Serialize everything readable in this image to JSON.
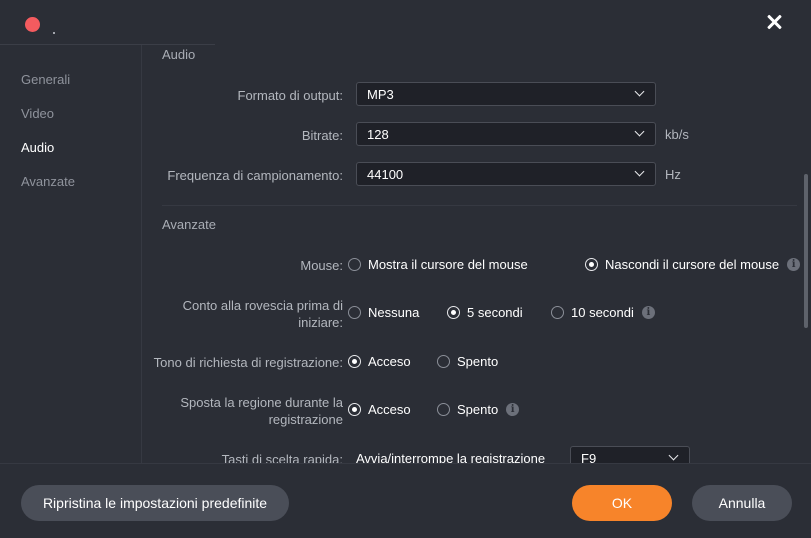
{
  "sidebar": {
    "items": [
      {
        "label": "Generali",
        "active": false
      },
      {
        "label": "Video",
        "active": false
      },
      {
        "label": "Audio",
        "active": true
      },
      {
        "label": "Avanzate",
        "active": false
      }
    ]
  },
  "audio": {
    "title": "Audio",
    "format_label": "Formato di output:",
    "format_value": "MP3",
    "bitrate_label": "Bitrate:",
    "bitrate_value": "128",
    "bitrate_unit": "kb/s",
    "samplerate_label": "Frequenza di campionamento:",
    "samplerate_value": "44100",
    "samplerate_unit": "Hz"
  },
  "advanced": {
    "title": "Avanzate",
    "mouse_label": "Mouse:",
    "mouse_show": "Mostra il cursore del mouse",
    "mouse_hide": "Nascondi il cursore del mouse",
    "countdown_label_1": "Conto alla rovescia prima di",
    "countdown_label_2": "iniziare:",
    "countdown_none": "Nessuna",
    "countdown_5": "5 secondi",
    "countdown_10": "10 secondi",
    "tone_label": "Tono di richiesta di registrazione:",
    "tone_on": "Acceso",
    "tone_off": "Spento",
    "move_label_1": "Sposta la regione durante la",
    "move_label_2": "registrazione",
    "move_on": "Acceso",
    "move_off": "Spento",
    "hotkeys_label": "Tasti di scelta rapida:",
    "hotkeys_action": "Avvia/interrompe la registrazione",
    "hotkeys_value": "F9"
  },
  "icons": {
    "info": "i"
  },
  "footer": {
    "reset_label": "Ripristina le impostazioni predefinite",
    "ok_label": "OK",
    "cancel_label": "Annulla"
  },
  "colors": {
    "accent": "#f7842a",
    "background": "#2b2e36",
    "close_dot": "#f45b5f"
  }
}
